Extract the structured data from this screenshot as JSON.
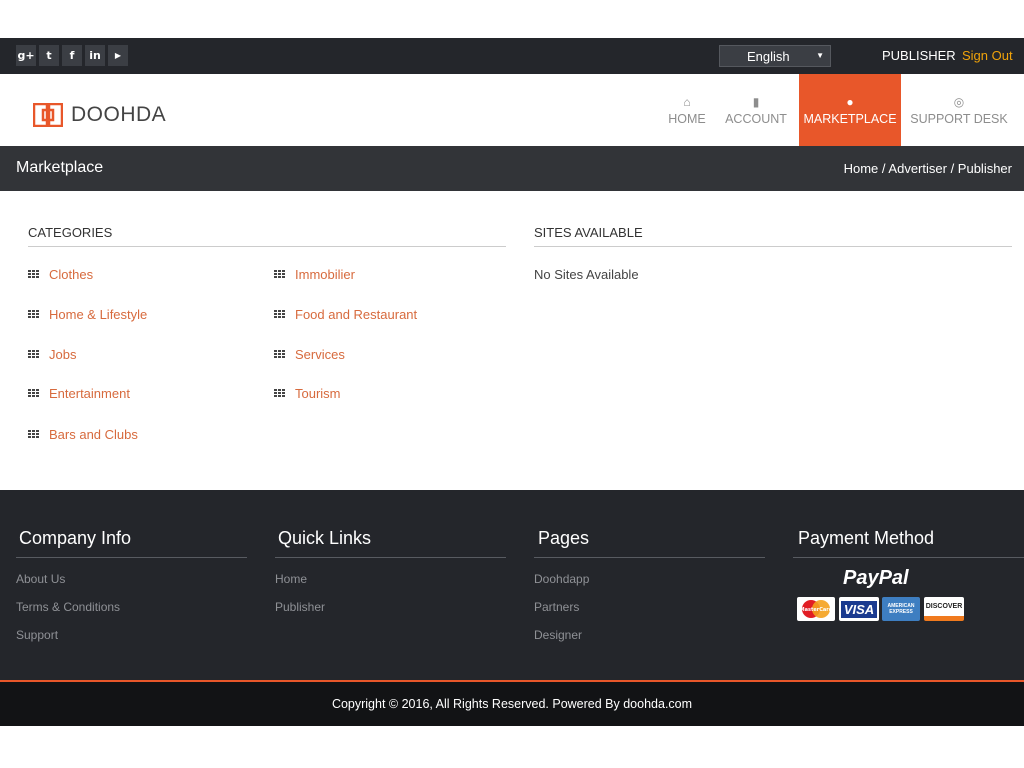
{
  "topbar": {
    "social": [
      {
        "name": "google-plus-icon",
        "glyph": "g+"
      },
      {
        "name": "twitter-icon",
        "glyph": "t"
      },
      {
        "name": "facebook-icon",
        "glyph": "f"
      },
      {
        "name": "linkedin-icon",
        "glyph": "in"
      },
      {
        "name": "youtube-icon",
        "glyph": "▶"
      }
    ],
    "language": "English",
    "role": "PUBLISHER",
    "signout": "Sign Out"
  },
  "header": {
    "logo_text": "DOOHDA",
    "nav": [
      {
        "label": "HOME",
        "icon": "home-icon",
        "glyph": "⌂",
        "active": false
      },
      {
        "label": "ACCOUNT",
        "icon": "briefcase-icon",
        "glyph": "▮",
        "active": false
      },
      {
        "label": "MARKETPLACE",
        "icon": "users-icon",
        "glyph": "●",
        "active": true
      },
      {
        "label": "SUPPORT DESK",
        "icon": "lifebuoy-icon",
        "glyph": "◎",
        "active": false
      }
    ]
  },
  "titlebar": {
    "title": "Marketplace",
    "breadcrumb": [
      "Home",
      "Advertiser",
      "Publisher"
    ],
    "separator": " / "
  },
  "categories": {
    "heading": "CATEGORIES",
    "left": [
      "Clothes",
      "Home & Lifestyle",
      "Jobs",
      "Entertainment",
      "Bars and Clubs"
    ],
    "right": [
      "Immobilier",
      "Food and Restaurant",
      "Services",
      "Tourism"
    ]
  },
  "sites": {
    "heading": "SITES AVAILABLE",
    "empty_text": "No Sites Available"
  },
  "footer": {
    "company": {
      "title": "Company Info",
      "links": [
        "About Us",
        "Terms & Conditions",
        "Support"
      ]
    },
    "quick": {
      "title": "Quick Links",
      "links": [
        "Home",
        "Publisher"
      ]
    },
    "pages": {
      "title": "Pages",
      "links": [
        "Doohdapp",
        "Partners",
        "Designer"
      ]
    },
    "payment": {
      "title": "Payment Method",
      "paypal": "PayPal",
      "cards": [
        "MasterCard",
        "VISA",
        "AMERICAN EXPRESS",
        "DISCOVER"
      ]
    },
    "copyright": "Copyright © 2016, All Rights Reserved. Powered By doohda.com"
  },
  "colors": {
    "accent": "#e8572a",
    "link": "#d76a3d",
    "signout": "#f0a30a",
    "dark": "#24262b"
  }
}
